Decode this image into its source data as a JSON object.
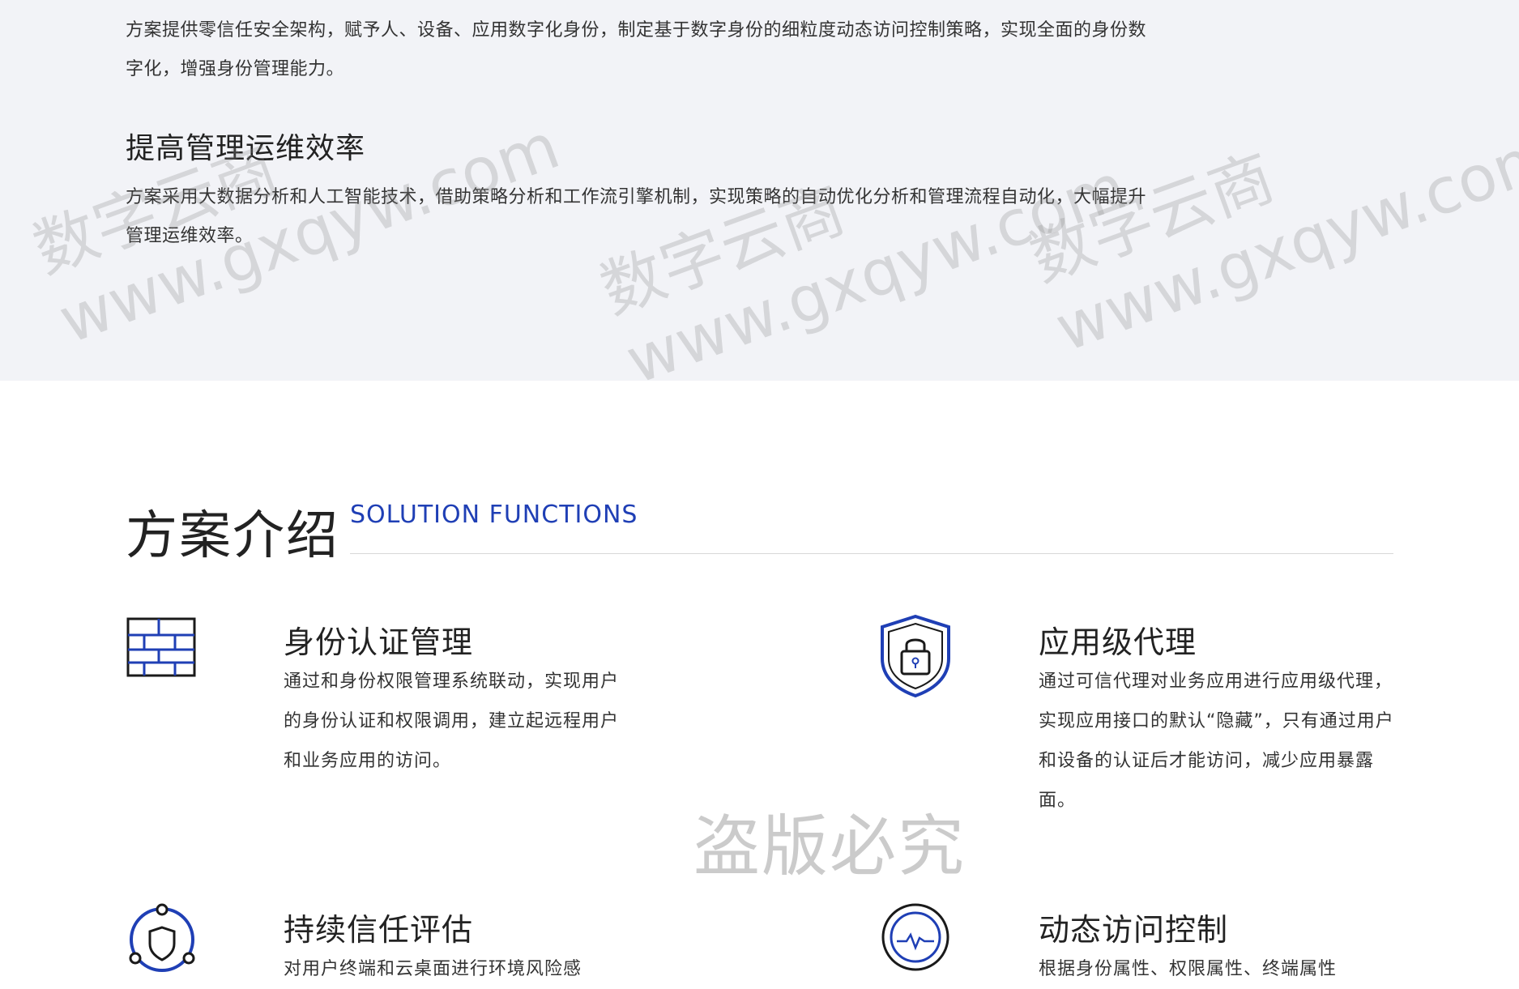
{
  "top": {
    "paragraph1": "方案提供零信任安全架构，赋予人、设备、应用数字化身份，制定基于数字身份的细粒度动态访问控制策略，实现全面的身份数字化，增强身份管理能力。",
    "subheading": "提高管理运维效率",
    "paragraph2": "方案采用大数据分析和人工智能技术，借助策略分析和工作流引擎机制，实现策略的自动优化分析和管理流程自动化，大幅提升管理运维效率。"
  },
  "watermarks": {
    "line1": "数字云商",
    "line2": "www.gxqyw.com"
  },
  "section": {
    "title": "方案介绍",
    "subtitle": "SOLUTION FUNCTIONS"
  },
  "features": [
    {
      "title": "身份认证管理",
      "desc": "通过和身份权限管理系统联动，实现用户的身份认证和权限调用，建立起远程用户和业务应用的访问。",
      "icon": "firewall-icon"
    },
    {
      "title": "应用级代理",
      "desc": "通过可信代理对业务应用进行应用级代理，实现应用接口的默认“隐藏”，只有通过用户和设备的认证后才能访问，减少应用暴露面。",
      "icon": "shield-lock-icon"
    },
    {
      "title": "持续信任评估",
      "desc": "对用户终端和云桌面进行环境风险感",
      "icon": "network-shield-icon"
    },
    {
      "title": "动态访问控制",
      "desc": "根据身份属性、权限属性、终端属性",
      "icon": "monitor-circle-icon"
    }
  ],
  "piracy_mark": "盗版必究",
  "colors": {
    "accent": "#1f3fb5",
    "top_background": "#f2f3f7"
  }
}
